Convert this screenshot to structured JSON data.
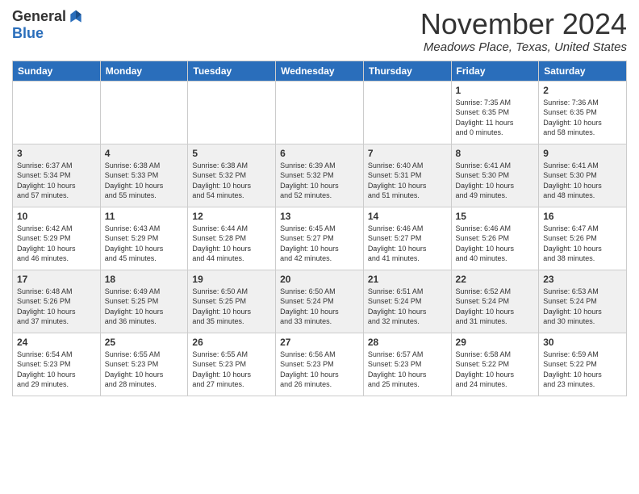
{
  "header": {
    "logo_general": "General",
    "logo_blue": "Blue",
    "month_title": "November 2024",
    "location": "Meadows Place, Texas, United States"
  },
  "weekdays": [
    "Sunday",
    "Monday",
    "Tuesday",
    "Wednesday",
    "Thursday",
    "Friday",
    "Saturday"
  ],
  "weeks": [
    [
      {
        "day": "",
        "info": ""
      },
      {
        "day": "",
        "info": ""
      },
      {
        "day": "",
        "info": ""
      },
      {
        "day": "",
        "info": ""
      },
      {
        "day": "",
        "info": ""
      },
      {
        "day": "1",
        "info": "Sunrise: 7:35 AM\nSunset: 6:35 PM\nDaylight: 11 hours\nand 0 minutes."
      },
      {
        "day": "2",
        "info": "Sunrise: 7:36 AM\nSunset: 6:35 PM\nDaylight: 10 hours\nand 58 minutes."
      }
    ],
    [
      {
        "day": "3",
        "info": "Sunrise: 6:37 AM\nSunset: 5:34 PM\nDaylight: 10 hours\nand 57 minutes."
      },
      {
        "day": "4",
        "info": "Sunrise: 6:38 AM\nSunset: 5:33 PM\nDaylight: 10 hours\nand 55 minutes."
      },
      {
        "day": "5",
        "info": "Sunrise: 6:38 AM\nSunset: 5:32 PM\nDaylight: 10 hours\nand 54 minutes."
      },
      {
        "day": "6",
        "info": "Sunrise: 6:39 AM\nSunset: 5:32 PM\nDaylight: 10 hours\nand 52 minutes."
      },
      {
        "day": "7",
        "info": "Sunrise: 6:40 AM\nSunset: 5:31 PM\nDaylight: 10 hours\nand 51 minutes."
      },
      {
        "day": "8",
        "info": "Sunrise: 6:41 AM\nSunset: 5:30 PM\nDaylight: 10 hours\nand 49 minutes."
      },
      {
        "day": "9",
        "info": "Sunrise: 6:41 AM\nSunset: 5:30 PM\nDaylight: 10 hours\nand 48 minutes."
      }
    ],
    [
      {
        "day": "10",
        "info": "Sunrise: 6:42 AM\nSunset: 5:29 PM\nDaylight: 10 hours\nand 46 minutes."
      },
      {
        "day": "11",
        "info": "Sunrise: 6:43 AM\nSunset: 5:29 PM\nDaylight: 10 hours\nand 45 minutes."
      },
      {
        "day": "12",
        "info": "Sunrise: 6:44 AM\nSunset: 5:28 PM\nDaylight: 10 hours\nand 44 minutes."
      },
      {
        "day": "13",
        "info": "Sunrise: 6:45 AM\nSunset: 5:27 PM\nDaylight: 10 hours\nand 42 minutes."
      },
      {
        "day": "14",
        "info": "Sunrise: 6:46 AM\nSunset: 5:27 PM\nDaylight: 10 hours\nand 41 minutes."
      },
      {
        "day": "15",
        "info": "Sunrise: 6:46 AM\nSunset: 5:26 PM\nDaylight: 10 hours\nand 40 minutes."
      },
      {
        "day": "16",
        "info": "Sunrise: 6:47 AM\nSunset: 5:26 PM\nDaylight: 10 hours\nand 38 minutes."
      }
    ],
    [
      {
        "day": "17",
        "info": "Sunrise: 6:48 AM\nSunset: 5:26 PM\nDaylight: 10 hours\nand 37 minutes."
      },
      {
        "day": "18",
        "info": "Sunrise: 6:49 AM\nSunset: 5:25 PM\nDaylight: 10 hours\nand 36 minutes."
      },
      {
        "day": "19",
        "info": "Sunrise: 6:50 AM\nSunset: 5:25 PM\nDaylight: 10 hours\nand 35 minutes."
      },
      {
        "day": "20",
        "info": "Sunrise: 6:50 AM\nSunset: 5:24 PM\nDaylight: 10 hours\nand 33 minutes."
      },
      {
        "day": "21",
        "info": "Sunrise: 6:51 AM\nSunset: 5:24 PM\nDaylight: 10 hours\nand 32 minutes."
      },
      {
        "day": "22",
        "info": "Sunrise: 6:52 AM\nSunset: 5:24 PM\nDaylight: 10 hours\nand 31 minutes."
      },
      {
        "day": "23",
        "info": "Sunrise: 6:53 AM\nSunset: 5:24 PM\nDaylight: 10 hours\nand 30 minutes."
      }
    ],
    [
      {
        "day": "24",
        "info": "Sunrise: 6:54 AM\nSunset: 5:23 PM\nDaylight: 10 hours\nand 29 minutes."
      },
      {
        "day": "25",
        "info": "Sunrise: 6:55 AM\nSunset: 5:23 PM\nDaylight: 10 hours\nand 28 minutes."
      },
      {
        "day": "26",
        "info": "Sunrise: 6:55 AM\nSunset: 5:23 PM\nDaylight: 10 hours\nand 27 minutes."
      },
      {
        "day": "27",
        "info": "Sunrise: 6:56 AM\nSunset: 5:23 PM\nDaylight: 10 hours\nand 26 minutes."
      },
      {
        "day": "28",
        "info": "Sunrise: 6:57 AM\nSunset: 5:23 PM\nDaylight: 10 hours\nand 25 minutes."
      },
      {
        "day": "29",
        "info": "Sunrise: 6:58 AM\nSunset: 5:22 PM\nDaylight: 10 hours\nand 24 minutes."
      },
      {
        "day": "30",
        "info": "Sunrise: 6:59 AM\nSunset: 5:22 PM\nDaylight: 10 hours\nand 23 minutes."
      }
    ]
  ]
}
